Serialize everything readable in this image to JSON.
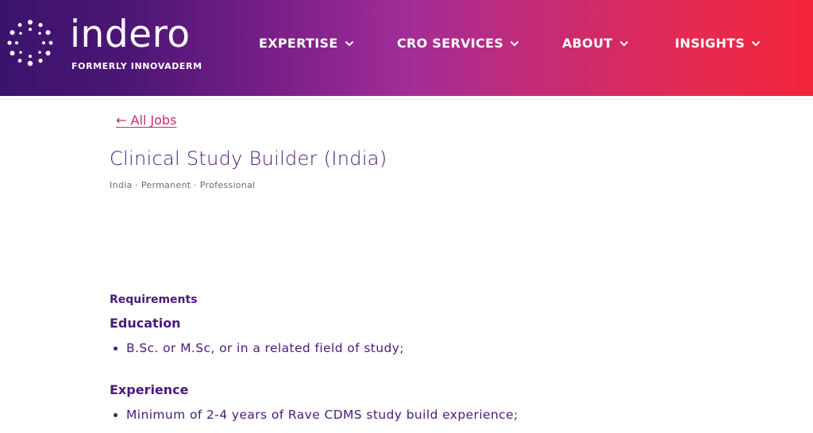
{
  "header": {
    "brand_name": "indero",
    "brand_subtitle": "FORMERLY INNOVADERM",
    "colors": {
      "gradient_start": "#3b136d",
      "gradient_mid": "#a22d98",
      "gradient_end": "#f2243a"
    },
    "nav": [
      {
        "label": "EXPERTISE",
        "icon": "chevron-down-icon"
      },
      {
        "label": "CRO SERVICES",
        "icon": "chevron-down-icon"
      },
      {
        "label": "ABOUT",
        "icon": "chevron-down-icon"
      },
      {
        "label": "INSIGHTS",
        "icon": "chevron-down-icon"
      }
    ]
  },
  "job": {
    "back_link": "← All Jobs",
    "title": "Clinical Study Builder (India)",
    "meta": "India · Permanent · Professional",
    "requirements_label": "Requirements",
    "education": {
      "heading": "Education",
      "items": [
        "B.Sc. or M.Sc, or in a related field of study;"
      ]
    },
    "experience": {
      "heading": "Experience",
      "items": [
        "Minimum of 2-4 years of Rave CDMS study build experience;"
      ]
    }
  },
  "colors": {
    "accent_link": "#c2306a",
    "text_primary": "#4a1a7a",
    "meta_text": "#6b6b6b"
  }
}
